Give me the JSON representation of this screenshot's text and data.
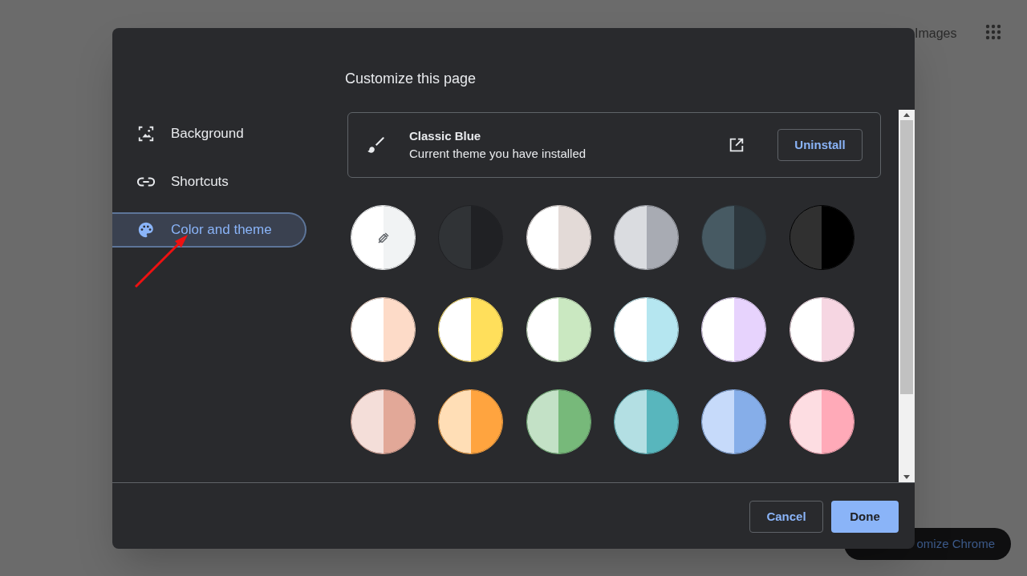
{
  "background_page": {
    "top_link": "Images",
    "customize_button": "omize Chrome"
  },
  "dialog": {
    "title": "Customize this page",
    "sidebar": {
      "items": [
        {
          "kind": "background",
          "label": "Background",
          "selected": false
        },
        {
          "kind": "shortcuts",
          "label": "Shortcuts",
          "selected": false
        },
        {
          "kind": "palette",
          "label": "Color and theme",
          "selected": true
        }
      ]
    },
    "theme_card": {
      "name": "Classic Blue",
      "description": "Current theme you have installed",
      "button": "Uninstall"
    },
    "swatches": [
      {
        "kind": "custom",
        "halves": [
          {
            "color": "#ffffff"
          },
          {
            "color": "#f1f3f4"
          }
        ]
      },
      {
        "kind": "preset",
        "halves": [
          {
            "color": "#303336"
          },
          {
            "color": "#202124"
          }
        ]
      },
      {
        "kind": "preset",
        "halves": [
          {
            "color": "#ffffff"
          },
          {
            "color": "#e3dad7"
          }
        ]
      },
      {
        "kind": "preset",
        "halves": [
          {
            "color": "#dadce0"
          },
          {
            "color": "#a8abb3"
          }
        ]
      },
      {
        "kind": "preset",
        "halves": [
          {
            "color": "#475a63"
          },
          {
            "color": "#2d373d"
          }
        ]
      },
      {
        "kind": "preset",
        "halves": [
          {
            "color": "#303030"
          },
          {
            "color": "#000000"
          }
        ]
      },
      {
        "kind": "preset",
        "halves": [
          {
            "color": "#ffffff"
          },
          {
            "color": "#fddbc8"
          }
        ]
      },
      {
        "kind": "preset",
        "halves": [
          {
            "color": "#ffffff"
          },
          {
            "color": "#ffdf5b"
          }
        ]
      },
      {
        "kind": "preset",
        "halves": [
          {
            "color": "#ffffff"
          },
          {
            "color": "#cae8c1"
          }
        ]
      },
      {
        "kind": "preset",
        "halves": [
          {
            "color": "#ffffff"
          },
          {
            "color": "#b5e6f0"
          }
        ]
      },
      {
        "kind": "preset",
        "halves": [
          {
            "color": "#ffffff"
          },
          {
            "color": "#e7d3fd"
          }
        ]
      },
      {
        "kind": "preset",
        "halves": [
          {
            "color": "#ffffff"
          },
          {
            "color": "#f6d6e2"
          }
        ]
      },
      {
        "kind": "preset",
        "halves": [
          {
            "color": "#f4ded9"
          },
          {
            "color": "#e2a898"
          }
        ]
      },
      {
        "kind": "preset",
        "halves": [
          {
            "color": "#ffdeb6"
          },
          {
            "color": "#ffa43f"
          }
        ]
      },
      {
        "kind": "preset",
        "halves": [
          {
            "color": "#c3e1c6"
          },
          {
            "color": "#77b97a"
          }
        ]
      },
      {
        "kind": "preset",
        "halves": [
          {
            "color": "#b3dfe3"
          },
          {
            "color": "#58b6bd"
          }
        ]
      },
      {
        "kind": "preset",
        "halves": [
          {
            "color": "#c6dafa"
          },
          {
            "color": "#86aee9"
          }
        ]
      },
      {
        "kind": "preset",
        "halves": [
          {
            "color": "#fddde2"
          },
          {
            "color": "#ffaab8"
          }
        ]
      }
    ],
    "buttons": [
      {
        "kind": "secondary",
        "label": "Cancel"
      },
      {
        "kind": "primary",
        "label": "Done"
      }
    ]
  }
}
